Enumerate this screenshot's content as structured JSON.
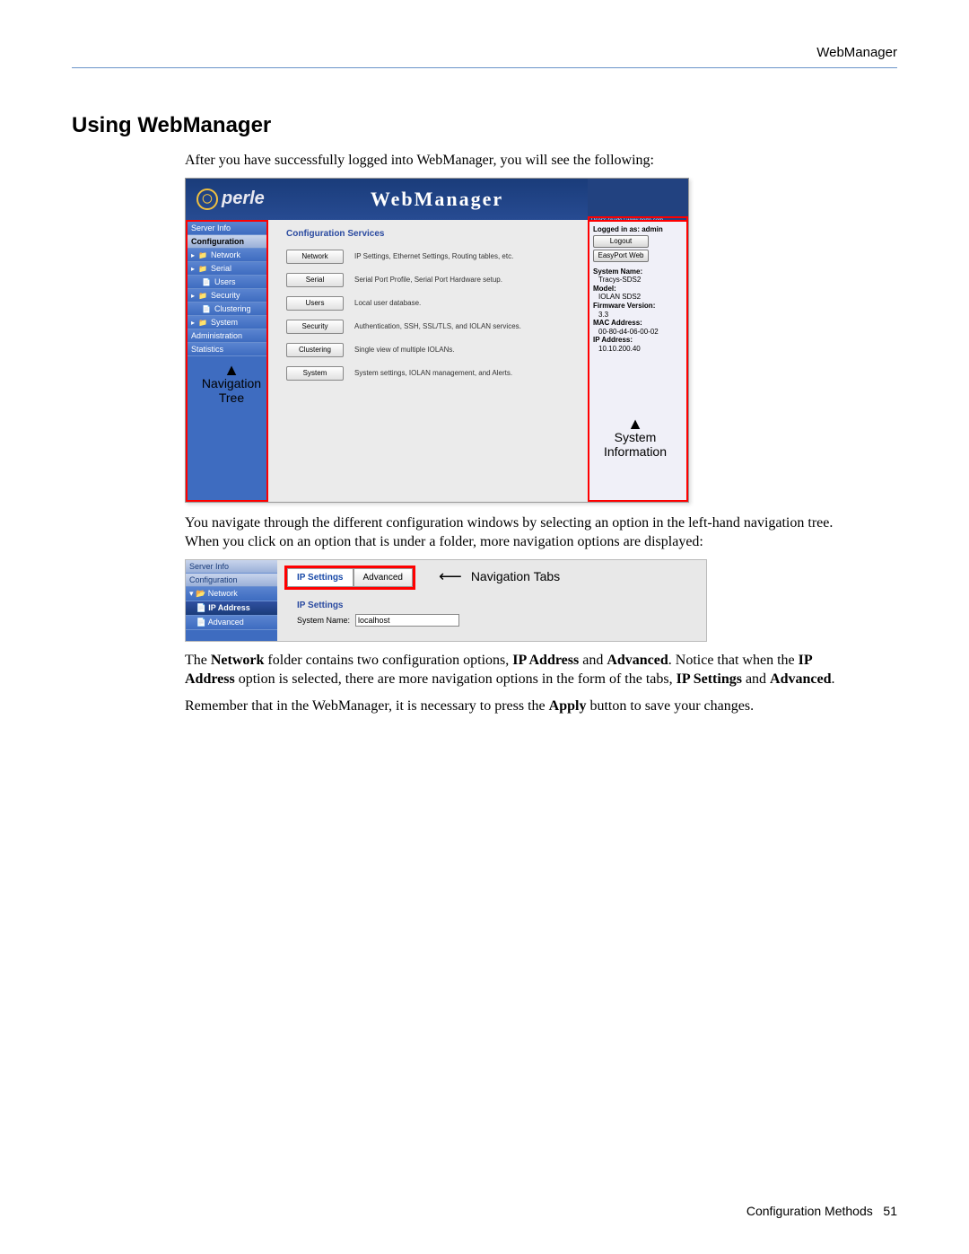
{
  "page_header": "WebManager",
  "section_title": "Using WebManager",
  "intro": "After you have successfully logged into WebManager, you will see the following:",
  "para2": "You navigate through the different configuration windows by selecting an option in the left-hand navigation tree. When you click on an option that is under a folder, more navigation options are displayed:",
  "para3_pre": "The ",
  "para3_b1": "Network",
  "para3_mid1": " folder contains two configuration options, ",
  "para3_b2": "IP Address",
  "para3_mid2": " and ",
  "para3_b3": "Advanced",
  "para3_mid3": ". Notice that when the ",
  "para3_b4": "IP Address",
  "para3_mid4": " option is selected, there are more navigation options in the form of the tabs, ",
  "para3_b5": "IP Settings",
  "para3_mid5": " and ",
  "para3_b6": "Advanced",
  "para3_end": ".",
  "para4_pre": "Remember that in the WebManager, it is necessary to press the ",
  "para4_b1": "Apply",
  "para4_post": " button to save your changes.",
  "ss1": {
    "logo": "perle",
    "title": "WebManager",
    "top_links": "User's Guide | www.perle.com",
    "nav": [
      "Server Info",
      "Configuration",
      "Network",
      "Serial",
      "Users",
      "Security",
      "Clustering",
      "System",
      "Administration",
      "Statistics"
    ],
    "nav_annot": "Navigation Tree",
    "section": "Configuration Services",
    "services": [
      {
        "btn": "Network",
        "desc": "IP Settings, Ethernet Settings, Routing tables, etc."
      },
      {
        "btn": "Serial",
        "desc": "Serial Port Profile, Serial Port Hardware setup."
      },
      {
        "btn": "Users",
        "desc": "Local user database."
      },
      {
        "btn": "Security",
        "desc": "Authentication, SSH, SSL/TLS, and IOLAN services."
      },
      {
        "btn": "Clustering",
        "desc": "Single view of multiple IOLANs."
      },
      {
        "btn": "System",
        "desc": "System settings, IOLAN management, and Alerts."
      }
    ],
    "right": {
      "logged_in": "Logged in as: admin",
      "logout": "Logout",
      "easyport": "EasyPort Web",
      "sys_name_l": "System Name:",
      "sys_name_v": "Tracys-SDS2",
      "model_l": "Model:",
      "model_v": "IOLAN SDS2",
      "fw_l": "Firmware Version:",
      "fw_v": "3.3",
      "mac_l": "MAC Address:",
      "mac_v": "00-80-d4-06-00-02",
      "ip_l": "IP Address:",
      "ip_v": "10.10.200.40"
    },
    "sys_annot": "System Information"
  },
  "ss2": {
    "nav": [
      "Server Info",
      "Configuration",
      "Network",
      "IP Address",
      "Advanced"
    ],
    "tab1": "IP Settings",
    "tab2": "Advanced",
    "tabs_annot": "Navigation Tabs",
    "sec_title": "IP Settings",
    "field_label": "System Name:",
    "field_value": "localhost"
  },
  "footer_chapter": "Configuration Methods",
  "footer_page": "51"
}
